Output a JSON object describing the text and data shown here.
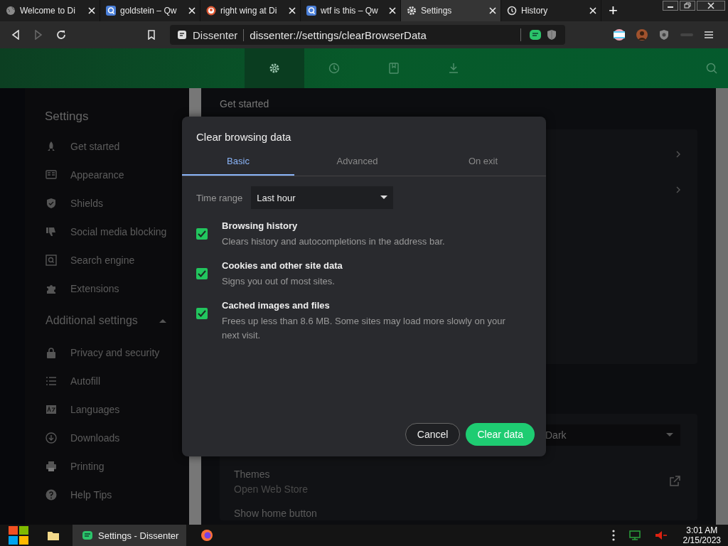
{
  "browser_tabs": [
    {
      "title": "Welcome to Di",
      "selected": false
    },
    {
      "title": "goldstein – Qw",
      "selected": false
    },
    {
      "title": "right wing at Di",
      "selected": false
    },
    {
      "title": "wtf is this – Qw",
      "selected": false
    },
    {
      "title": "Settings",
      "selected": true
    },
    {
      "title": "History",
      "selected": false
    }
  ],
  "new_tab": "+",
  "toolbar": {
    "forward_disabled": true,
    "site_label": "Dissenter",
    "url": "dissenter://settings/clearBrowserData"
  },
  "header_nav": [
    {
      "selected": true
    },
    {
      "selected": false
    },
    {
      "selected": false
    },
    {
      "selected": false
    }
  ],
  "sidebar": {
    "title": "Settings",
    "items": [
      {
        "label": "Get started"
      },
      {
        "label": "Appearance"
      },
      {
        "label": "Shields"
      },
      {
        "label": "Social media blocking"
      },
      {
        "label": "Search engine"
      },
      {
        "label": "Extensions"
      }
    ],
    "section": {
      "label": "Additional settings",
      "expanded": true
    },
    "more_items": [
      {
        "label": "Privacy and security"
      },
      {
        "label": "Autofill"
      },
      {
        "label": "Languages"
      },
      {
        "label": "Downloads"
      },
      {
        "label": "Printing"
      },
      {
        "label": "Help Tips"
      }
    ]
  },
  "main": {
    "heading": "Get started",
    "theme_value": "Dark",
    "themes_title": "Themes",
    "themes_sub": "Open Web Store",
    "home_button_label": "Show home button"
  },
  "dialog": {
    "title": "Clear browsing data",
    "tabs": [
      {
        "label": "Basic",
        "selected": true
      },
      {
        "label": "Advanced",
        "selected": false
      },
      {
        "label": "On exit",
        "selected": false
      }
    ],
    "time_range_label": "Time range",
    "time_range_value": "Last hour",
    "options": [
      {
        "title": "Browsing history",
        "desc": "Clears history and autocompletions in the address bar.",
        "checked": true
      },
      {
        "title": "Cookies and other site data",
        "desc": "Signs you out of most sites.",
        "checked": true
      },
      {
        "title": "Cached images and files",
        "desc": "Frees up less than 8.6 MB. Some sites may load more slowly on your next visit.",
        "checked": true
      }
    ],
    "cancel": "Cancel",
    "confirm": "Clear data"
  },
  "taskbar": {
    "task": "Settings - Dissenter",
    "task_selected": true,
    "time": "3:01 AM",
    "date": "2/15/2023"
  }
}
